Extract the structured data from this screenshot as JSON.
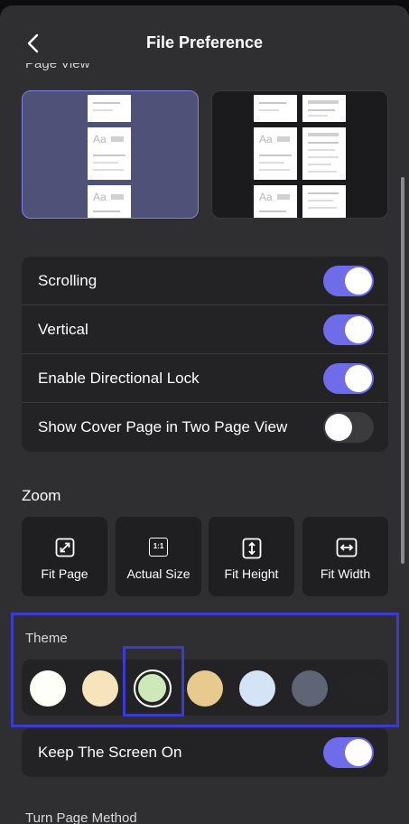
{
  "header": {
    "title": "File Preference",
    "back_icon": "chevron-left-icon",
    "section_above": "Page View"
  },
  "page_view": {
    "options": [
      {
        "name": "single-page",
        "selected": true
      },
      {
        "name": "two-page",
        "selected": false
      }
    ],
    "page_sample_text": "Aa"
  },
  "toggles": [
    {
      "label": "Scrolling",
      "on": true
    },
    {
      "label": "Vertical",
      "on": true
    },
    {
      "label": "Enable Directional Lock",
      "on": true
    },
    {
      "label": "Show Cover Page in Two Page View",
      "on": false
    }
  ],
  "zoom": {
    "label": "Zoom",
    "ratio_glyph": "1:1",
    "options": [
      {
        "label": "Fit Page",
        "icon": "fit-page-icon"
      },
      {
        "label": "Actual Size",
        "icon": "actual-size-icon"
      },
      {
        "label": "Fit Height",
        "icon": "fit-height-icon"
      },
      {
        "label": "Fit Width",
        "icon": "fit-width-icon"
      }
    ]
  },
  "theme": {
    "label": "Theme",
    "selected_index": 2,
    "swatches": [
      "#fefff8",
      "#f7e4bd",
      "#cde8b9",
      "#e8c98e",
      "#d4e3f5",
      "#5f6574",
      "#242426"
    ]
  },
  "keep_screen": {
    "label": "Keep The Screen On",
    "on": true
  },
  "turn_page": {
    "label": "Turn Page Method"
  },
  "colors": {
    "accent": "#6e6ce8",
    "highlight_frame": "#3b3ccf",
    "background": "#2f2f31",
    "card": "#232325"
  }
}
